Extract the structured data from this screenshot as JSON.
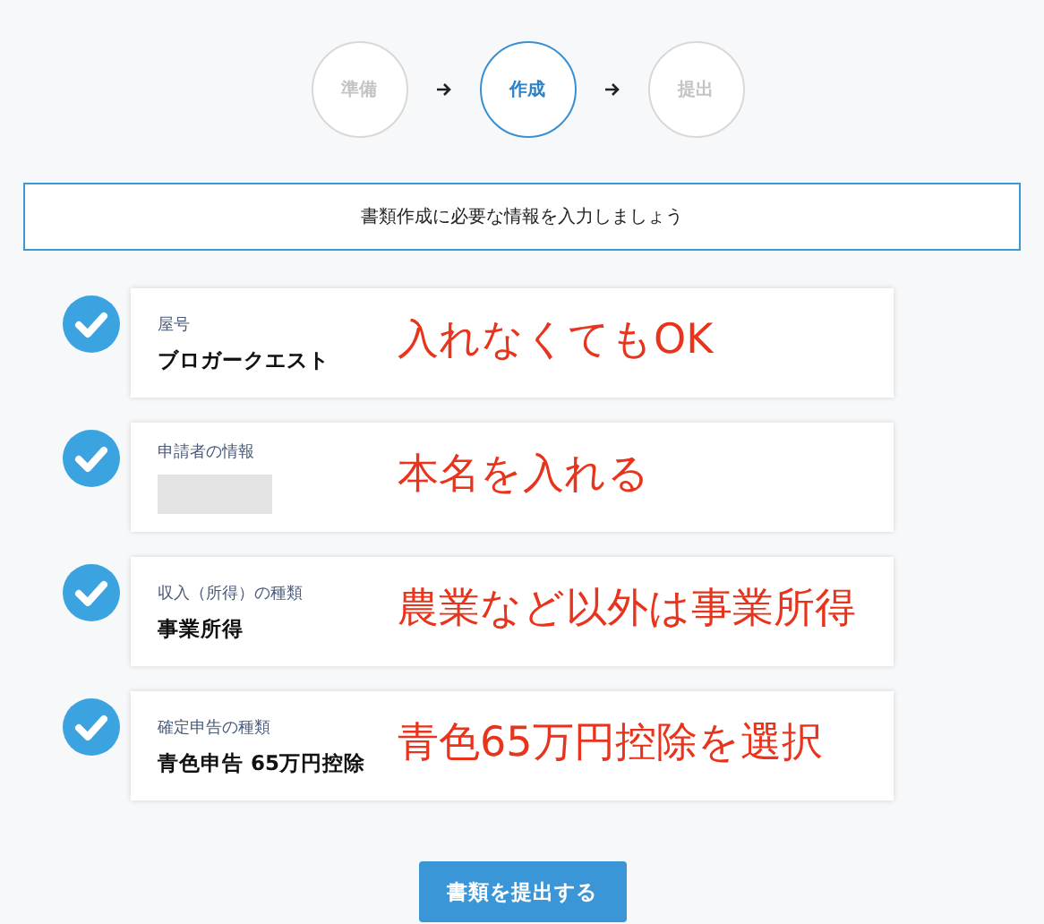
{
  "steps": [
    {
      "label": "準備",
      "selected": false
    },
    {
      "label": "作成",
      "selected": true
    },
    {
      "label": "提出",
      "selected": false
    }
  ],
  "banner": "書類作成に必要な情報を入力しましょう",
  "items": [
    {
      "label": "屋号",
      "value": "ブロガークエスト",
      "redacted": false,
      "checked": true,
      "note": "入れなくてもOK"
    },
    {
      "label": "申請者の情報",
      "redacted": true,
      "checked": true,
      "note": "本名を入れる"
    },
    {
      "label": "収入（所得）の種類",
      "value": "事業所得",
      "redacted": false,
      "checked": true,
      "note": "農業など以外は事業所得"
    },
    {
      "label": "確定申告の種類",
      "value": "青色申告 65万円控除",
      "redacted": false,
      "checked": true,
      "note": "青色65万円控除を選択"
    }
  ],
  "submit_button": "書類を提出する"
}
